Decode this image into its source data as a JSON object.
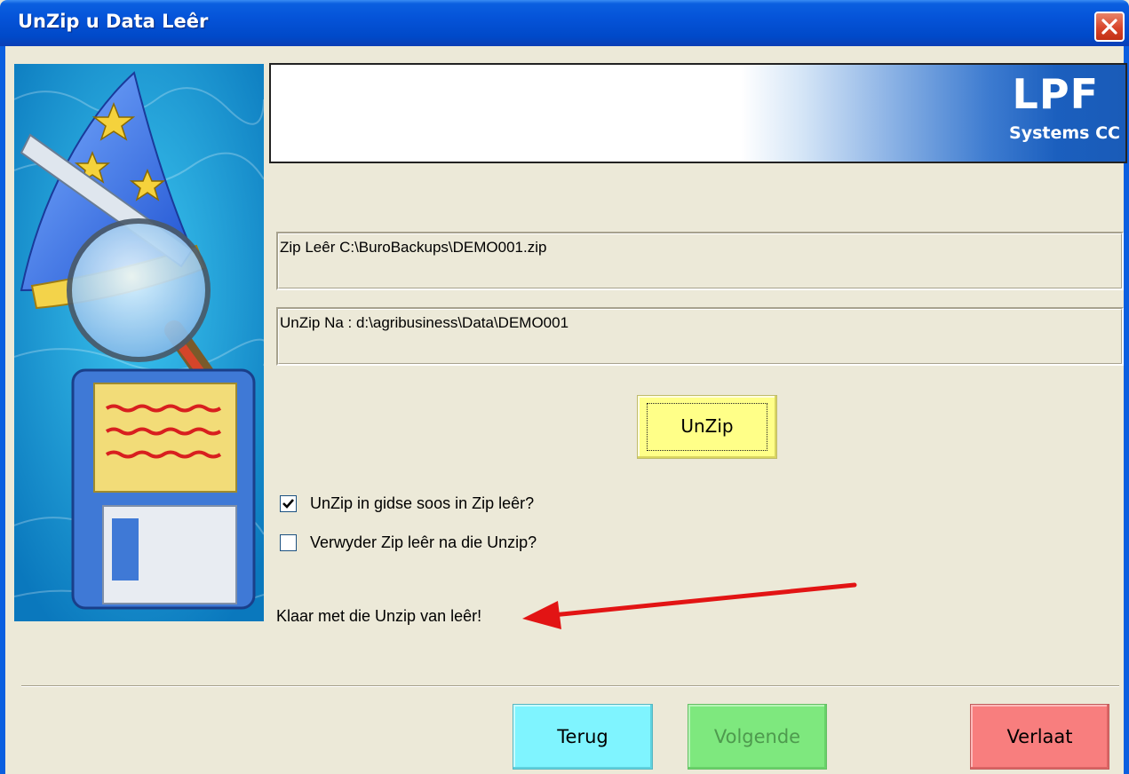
{
  "window": {
    "title": "UnZip u Data Leêr",
    "close_icon": "close-icon"
  },
  "banner": {
    "logo_main": "LPF",
    "logo_sub": "Systems CC"
  },
  "fields": {
    "zip_file": "Zip Leêr C:\\BuroBackups\\DEMO001.zip",
    "unzip_to": "UnZip Na : d:\\agribusiness\\Data\\DEMO001"
  },
  "unzip_button": {
    "label": "UnZip"
  },
  "options": {
    "keep_folders": {
      "label": "UnZip in gidse soos in Zip leêr?",
      "checked": true
    },
    "delete_zip": {
      "label": "Verwyder Zip leêr na die Unzip?",
      "checked": false
    }
  },
  "status": {
    "message": "Klaar met die Unzip van leêr!"
  },
  "annotation": {
    "icon": "red-arrow-icon",
    "color": "#e21414"
  },
  "nav": {
    "back_label": "Terug",
    "next_label": "Volgende",
    "exit_label": "Verlaat"
  },
  "colors": {
    "titlebar": "#0553d8",
    "unzip_button": "#ffff88",
    "back_button": "#7ff4ff",
    "next_button": "#7ee87e",
    "exit_button": "#f87e7e"
  }
}
